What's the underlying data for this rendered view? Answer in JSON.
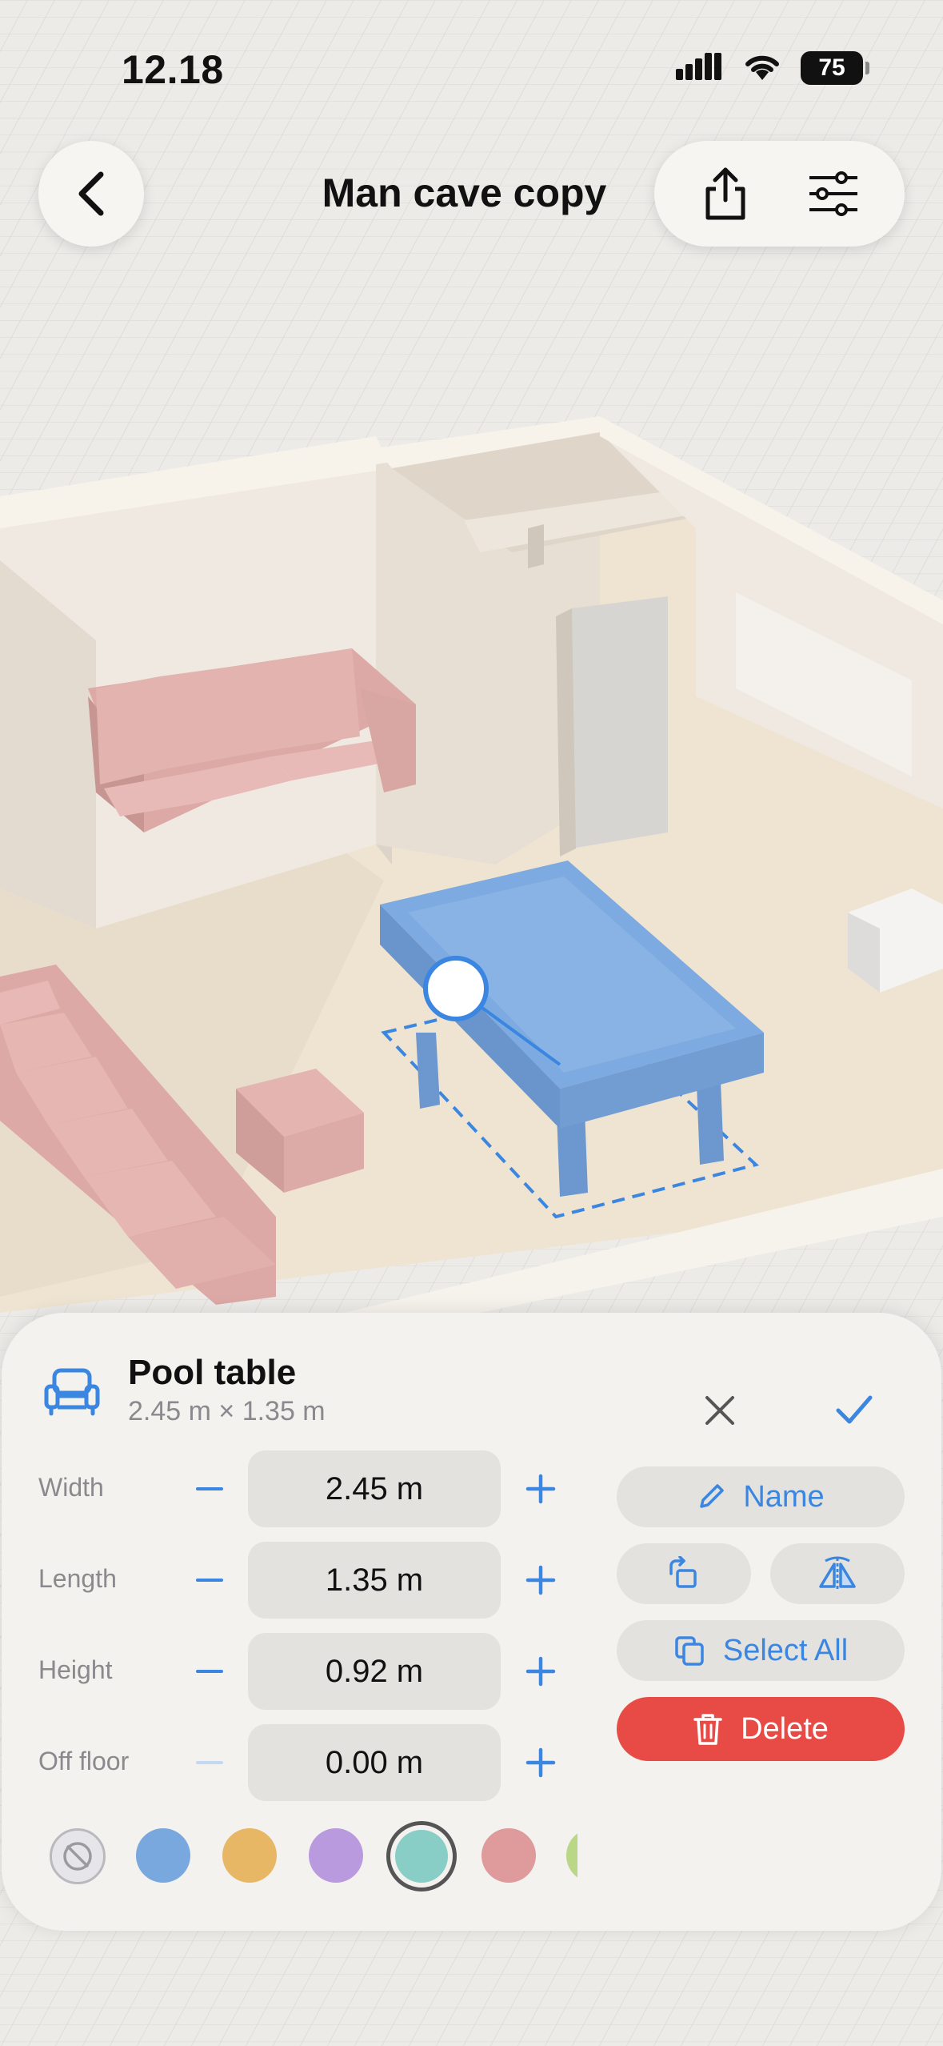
{
  "status_bar": {
    "time": "12.18",
    "battery": "75"
  },
  "header": {
    "title": "Man cave copy"
  },
  "object": {
    "name": "Pool table",
    "dimensions": "2.45 m × 1.35 m"
  },
  "dimensions": [
    {
      "label": "Width",
      "value": "2.45 m"
    },
    {
      "label": "Length",
      "value": "1.35 m"
    },
    {
      "label": "Height",
      "value": "0.92 m"
    },
    {
      "label": "Off floor",
      "value": "0.00 m"
    }
  ],
  "actions": {
    "name_label": "Name",
    "select_all_label": "Select All",
    "delete_label": "Delete"
  },
  "swatches": [
    {
      "name": "no-color",
      "color": "#e6e6ea"
    },
    {
      "name": "blue",
      "color": "#79a8de"
    },
    {
      "name": "yellow",
      "color": "#e8b765"
    },
    {
      "name": "purple",
      "color": "#b99ade"
    },
    {
      "name": "teal",
      "color": "#88cdc6",
      "selected": true
    },
    {
      "name": "pink",
      "color": "#df9a9b"
    },
    {
      "name": "green",
      "color": "#b9d787"
    }
  ],
  "colors": {
    "accent": "#3a86e0",
    "danger": "#e84a45",
    "selected_object": "#7daae0"
  }
}
